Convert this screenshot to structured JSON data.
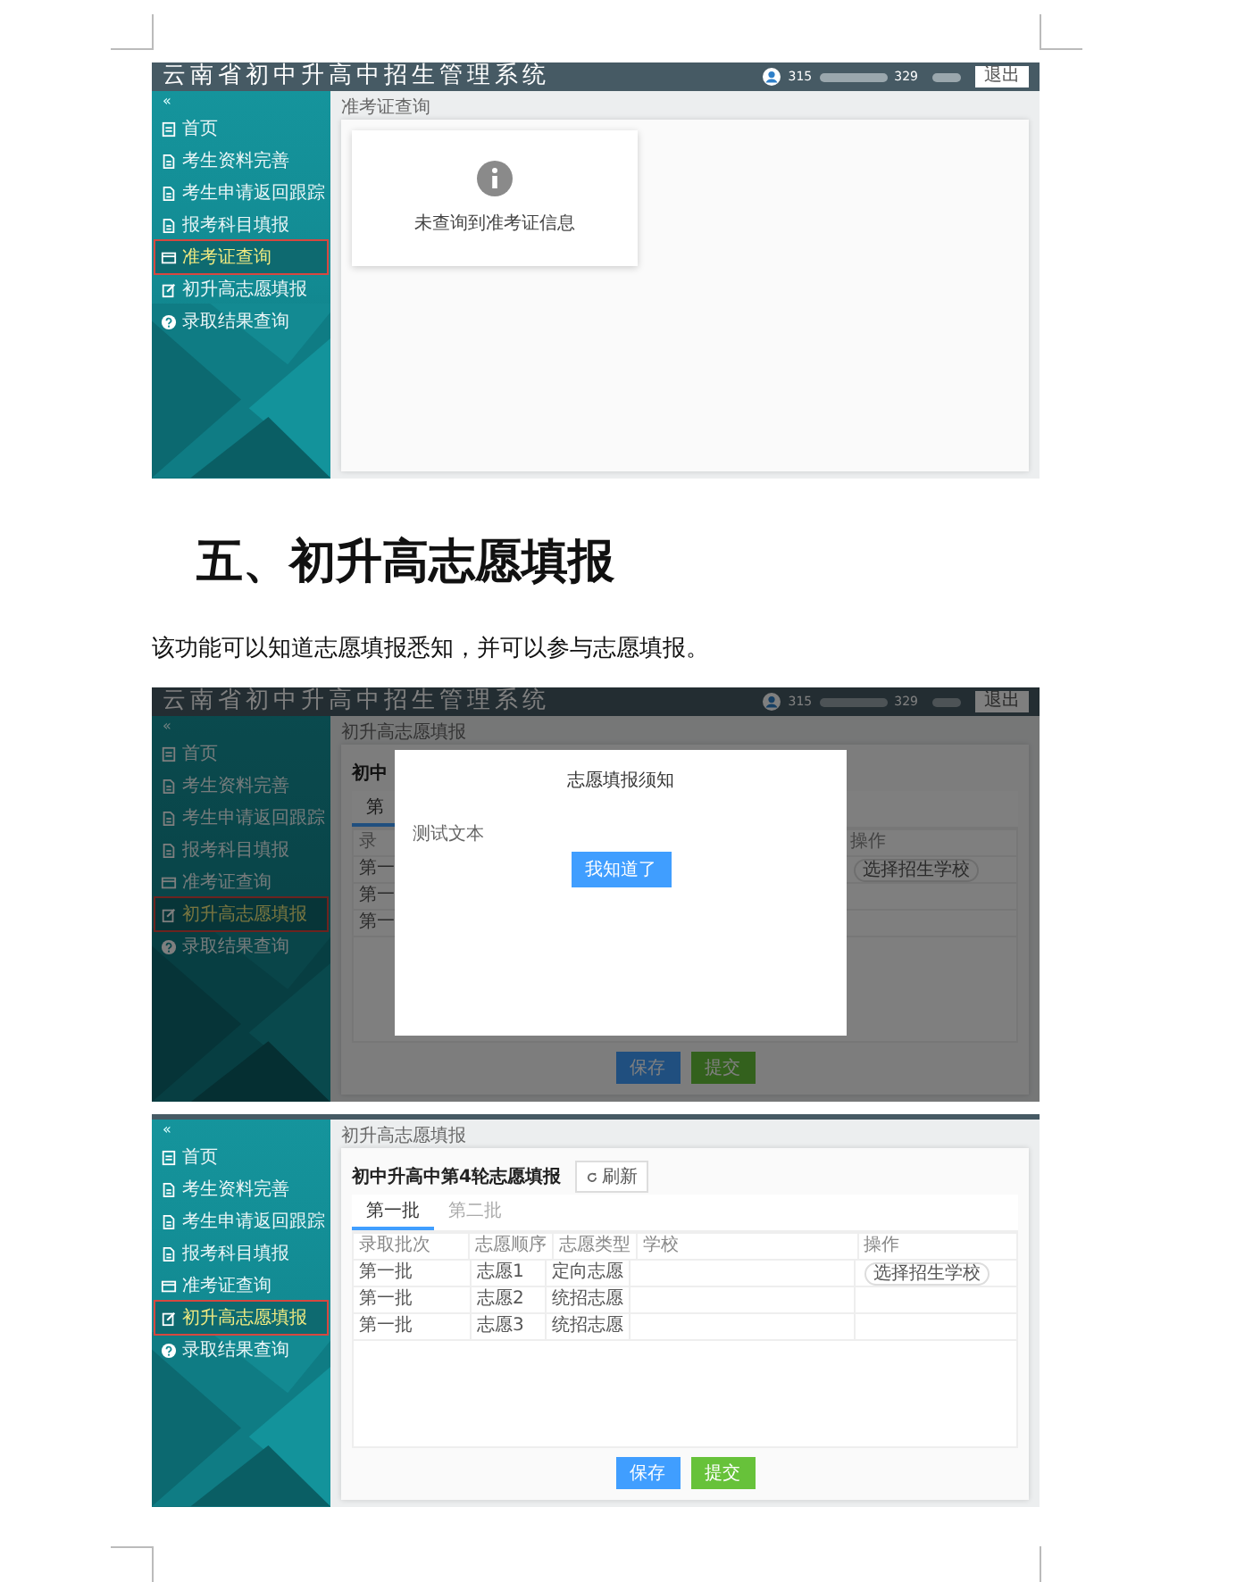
{
  "blocks": [
    {
      "kind": "screenshot",
      "header": {
        "title": "云南省初中升高中招生管理系统",
        "user_start": "315",
        "user_end": "329",
        "logout": "退出"
      },
      "sidebar": {
        "collapse": "«",
        "items": [
          {
            "kind": "page",
            "label": "首页",
            "selected": false
          },
          {
            "kind": "doc",
            "label": "考生资料完善",
            "selected": false
          },
          {
            "kind": "doc",
            "label": "考生申请返回跟踪",
            "selected": false
          },
          {
            "kind": "doc",
            "label": "报考科目填报",
            "selected": false
          },
          {
            "kind": "card",
            "label": "准考证查询",
            "selected": true
          },
          {
            "kind": "edit",
            "label": "初升高志愿填报",
            "selected": false
          },
          {
            "kind": "help",
            "label": "录取结果查询",
            "selected": false
          }
        ]
      },
      "breadcrumb": "准考证查询",
      "notice": {
        "message": "未查询到准考证信息"
      }
    },
    {
      "kind": "heading",
      "text": "五、初升高志愿填报"
    },
    {
      "kind": "paragraph",
      "text": "该功能可以知道志愿填报悉知，并可以参与志愿填报。"
    },
    {
      "kind": "screenshot",
      "header": {
        "title": "云南省初中升高中招生管理系统",
        "user_start": "315",
        "user_end": "329",
        "logout": "退出"
      },
      "sidebar": {
        "collapse": "«",
        "items": [
          {
            "kind": "page",
            "label": "首页",
            "selected": false
          },
          {
            "kind": "doc",
            "label": "考生资料完善",
            "selected": false
          },
          {
            "kind": "doc",
            "label": "考生申请返回跟踪",
            "selected": false
          },
          {
            "kind": "doc",
            "label": "报考科目填报",
            "selected": false
          },
          {
            "kind": "card",
            "label": "准考证查询",
            "selected": false
          },
          {
            "kind": "edit",
            "label": "初升高志愿填报",
            "selected": true
          },
          {
            "kind": "help",
            "label": "录取结果查询",
            "selected": false
          }
        ]
      },
      "breadcrumb": "初升高志愿填报",
      "form": {
        "title": "初中",
        "tabs": [
          {
            "label": "第",
            "selected": true
          }
        ],
        "columns": [
          "录",
          "操作"
        ],
        "rows": [
          {
            "cells": [
              "第一"
            ],
            "action": "选择招生学校"
          },
          {
            "cells": [
              "第一"
            ]
          },
          {
            "cells": [
              "第一"
            ]
          }
        ],
        "buttons": [
          {
            "kind": "save",
            "label": "保存"
          },
          {
            "kind": "submit",
            "label": "提交"
          }
        ]
      },
      "modal": {
        "title": "志愿填报须知",
        "body": "测试文本",
        "confirm": "我知道了"
      }
    },
    {
      "kind": "screenshot",
      "sidebar": {
        "collapse": "«",
        "items": [
          {
            "kind": "page",
            "label": "首页",
            "selected": false
          },
          {
            "kind": "doc",
            "label": "考生资料完善",
            "selected": false
          },
          {
            "kind": "doc",
            "label": "考生申请返回跟踪",
            "selected": false
          },
          {
            "kind": "doc",
            "label": "报考科目填报",
            "selected": false
          },
          {
            "kind": "card",
            "label": "准考证查询",
            "selected": false
          },
          {
            "kind": "edit",
            "label": "初升高志愿填报",
            "selected": true
          },
          {
            "kind": "help",
            "label": "录取结果查询",
            "selected": false
          }
        ]
      },
      "breadcrumb": "初升高志愿填报",
      "form": {
        "title": "初中升高中第4轮志愿填报",
        "refresh": "刷新",
        "tabs": [
          {
            "label": "第一批",
            "selected": true
          },
          {
            "label": "第二批",
            "selected": false
          }
        ],
        "columns": [
          "录取批次",
          "志愿顺序",
          "志愿类型",
          "学校",
          "操作"
        ],
        "rows": [
          {
            "cells": [
              "第一批",
              "志愿1",
              "定向志愿"
            ],
            "action": "选择招生学校"
          },
          {
            "cells": [
              "第一批",
              "志愿2",
              "统招志愿"
            ]
          },
          {
            "cells": [
              "第一批",
              "志愿3",
              "统招志愿"
            ]
          }
        ],
        "buttons": [
          {
            "kind": "save",
            "label": "保存"
          },
          {
            "kind": "submit",
            "label": "提交"
          }
        ]
      }
    }
  ]
}
